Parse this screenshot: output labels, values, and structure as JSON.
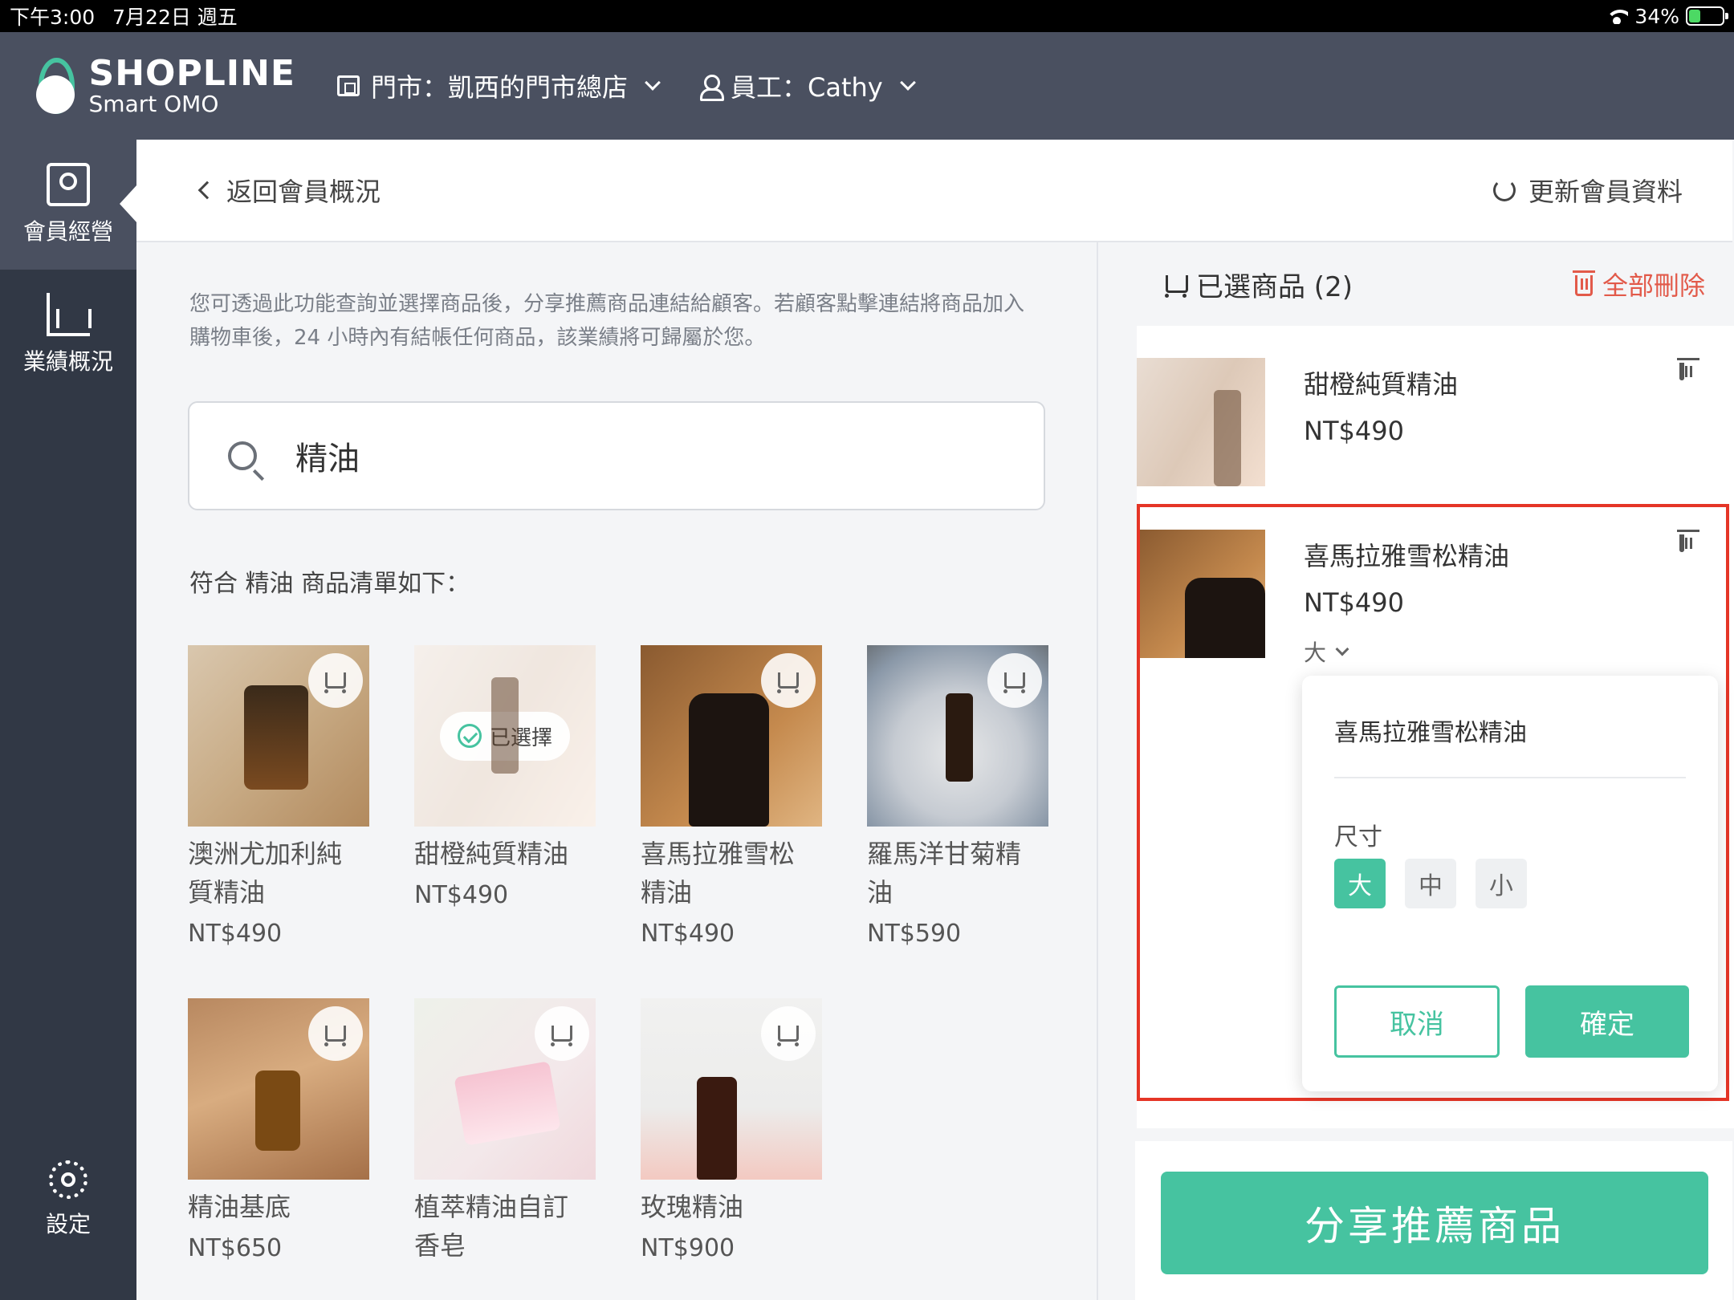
{
  "status_bar": {
    "time": "下午3:00",
    "date": "7月22日 週五",
    "battery": "34%",
    "battery_level": 0.34
  },
  "header": {
    "brand": "SHOPLINE",
    "sub_brand": "Smart OMO",
    "store_label": "門市：凱西的門市總店",
    "staff_label": "員工：Cathy"
  },
  "sidebar": {
    "items": [
      {
        "label": "會員經營",
        "icon": "member-card-icon",
        "active": true
      },
      {
        "label": "業績概況",
        "icon": "chart-icon",
        "active": false
      }
    ],
    "settings_label": "設定"
  },
  "subheader": {
    "back_label": "返回會員概況",
    "refresh_label": "更新會員資料"
  },
  "description": "您可透過此功能查詢並選擇商品後，分享推薦商品連結給顧客。若顧客點擊連結將商品加入購物車後，24 小時內有結帳任何商品，該業績將可歸屬於您。",
  "search": {
    "value": "精油"
  },
  "results_title": "符合 精油 商品清單如下：",
  "products": [
    {
      "name_line1": "澳洲尤加利純",
      "name_line2": "質精油",
      "price": "NT$490",
      "selected": false
    },
    {
      "name_line1": "甜橙純質精油",
      "name_line2": "",
      "price": "NT$490",
      "selected": true,
      "selected_label": "已選擇"
    },
    {
      "name_line1": "喜馬拉雅雪松",
      "name_line2": "精油",
      "price": "NT$490",
      "selected": false
    },
    {
      "name_line1": "羅馬洋甘菊精",
      "name_line2": "油",
      "price": "NT$590",
      "selected": false
    },
    {
      "name_line1": "精油基底",
      "name_line2": "",
      "price": "NT$650",
      "selected": false
    },
    {
      "name_line1": "植萃精油自訂",
      "name_line2": "香皂",
      "price": "",
      "selected": false
    },
    {
      "name_line1": "玫瑰精油",
      "name_line2": "",
      "price": "NT$900",
      "selected": false
    }
  ],
  "cart": {
    "title": "已選商品 (2)",
    "delete_all": "全部刪除",
    "items": [
      {
        "name": "甜橙純質精油",
        "price": "NT$490"
      },
      {
        "name": "喜馬拉雅雪松精油",
        "price": "NT$490",
        "variant": "大"
      }
    ]
  },
  "popover": {
    "title": "喜馬拉雅雪松精油",
    "size_label": "尺寸",
    "sizes": [
      "大",
      "中",
      "小"
    ],
    "selected_size": "大",
    "cancel": "取消",
    "confirm": "確定"
  },
  "share_button": "分享推薦商品",
  "colors": {
    "accent": "#46c3a0",
    "danger": "#e25a4a",
    "header_bg": "#4a5060",
    "sidebar_bg": "#313845",
    "highlight": "#e53526"
  }
}
